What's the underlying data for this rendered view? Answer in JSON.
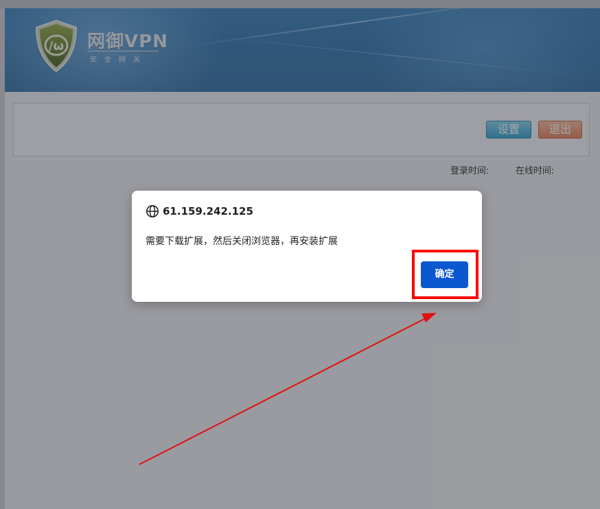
{
  "brand": {
    "title": "网御VPN",
    "subtitle": "安全网关"
  },
  "toolbar": {
    "settings_label": "设置",
    "logout_label": "退出"
  },
  "status": {
    "login_time_label": "登录时间:",
    "online_time_label": "在线时间:"
  },
  "dialog": {
    "origin": "61.159.242.125",
    "message": "需要下载扩展，然后关闭浏览器，再安装扩展",
    "ok_label": "确定",
    "icon": "globe-icon"
  },
  "annotation": {
    "highlight_color": "#ff0000",
    "arrow_color": "#e01010"
  },
  "colors": {
    "header_blue": "#2a6ea6",
    "primary_button": "#0b57d0"
  }
}
